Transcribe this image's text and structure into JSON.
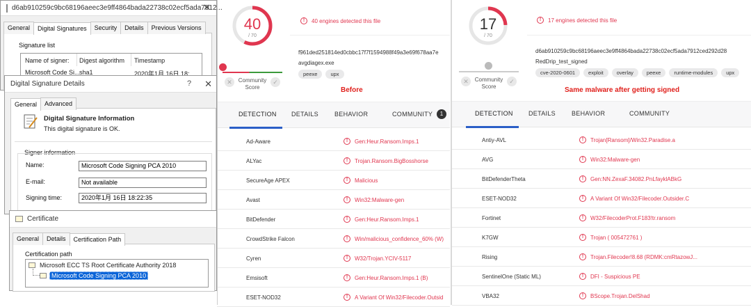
{
  "sig_list_window": {
    "title": "d6ab910259c9bc68196aeec3e9ff4864bada22738c02ecf5ada7912...",
    "tabs": [
      "General",
      "Digital Signatures",
      "Security",
      "Details",
      "Previous Versions"
    ],
    "group_label": "Signature list",
    "columns": [
      "Name of signer:",
      "Digest algorithm",
      "Timestamp"
    ],
    "row": [
      "Microsoft Code Si...",
      "sha1",
      "2020年1月 16日 18:..."
    ]
  },
  "sig_details_window": {
    "title": "Digital Signature Details",
    "help": "?",
    "tabs": [
      "General",
      "Advanced"
    ],
    "info_title": "Digital Signature Information",
    "info_text": "This digital signature is OK.",
    "group_label": "Signer information",
    "name_label": "Name:",
    "name_value": "Microsoft Code Signing PCA 2010",
    "email_label": "E-mail:",
    "email_value": "Not available",
    "time_label": "Signing time:",
    "time_value": "2020年1月 16日 18:22:35"
  },
  "cert_window": {
    "title": "Certificate",
    "tabs": [
      "General",
      "Details",
      "Certification Path"
    ],
    "path_label": "Certification path",
    "root": "Microsoft ECC TS Root Certificate Authority 2018",
    "child": "Microsoft Code Signing PCA 2010"
  },
  "vt_before": {
    "score": "40",
    "total": "/ 70",
    "alert": "40 engines detected this file",
    "hash": "f961ded251814ed0cbbc17f7f1594988f49a3e69f678aa7e",
    "filename": "avgdiagex.exe",
    "tags": [
      "peexe",
      "upx"
    ],
    "community_score": "Community Score",
    "caption": "Before",
    "nav": [
      "DETECTION",
      "DETAILS",
      "BEHAVIOR",
      "COMMUNITY"
    ],
    "community_badge": "1",
    "rows": [
      {
        "engine": "Ad-Aware",
        "result": "Gen:Heur.Ransom.Imps.1"
      },
      {
        "engine": "ALYac",
        "result": "Trojan.Ransom.BigBosshorse"
      },
      {
        "engine": "SecureAge APEX",
        "result": "Malicious"
      },
      {
        "engine": "Avast",
        "result": "Win32:Malware-gen"
      },
      {
        "engine": "BitDefender",
        "result": "Gen:Heur.Ransom.Imps.1"
      },
      {
        "engine": "CrowdStrike Falcon",
        "result": "Win/malicious_confidence_60% (W)"
      },
      {
        "engine": "Cyren",
        "result": "W32/Trojan.YCIV-5117"
      },
      {
        "engine": "Emsisoft",
        "result": "Gen:Heur.Ransom.Imps.1 (B)"
      },
      {
        "engine": "ESET-NOD32",
        "result": "A Variant Of Win32/Filecoder.Outsid"
      }
    ]
  },
  "vt_after": {
    "score": "17",
    "total": "/ 70",
    "alert": "17 engines detected this file",
    "hash": "d6ab910259c9bc68196aeec3e9ff4864bada22738c02ecf5ada7912ced292d28",
    "filename": "RedDrip_test_signed",
    "tags": [
      "cve-2020-0601",
      "exploit",
      "overlay",
      "peexe",
      "runtime-modules",
      "upx"
    ],
    "community_score": "Community Score",
    "caption": "Same malware after getting signed",
    "nav": [
      "DETECTION",
      "DETAILS",
      "BEHAVIOR",
      "COMMUNITY"
    ],
    "rows": [
      {
        "engine": "Antiy-AVL",
        "result": "Trojan[Ransom]/Win32.Paradise.a"
      },
      {
        "engine": "AVG",
        "result": "Win32:Malware-gen"
      },
      {
        "engine": "BitDefenderTheta",
        "result": "Gen:NN.ZexaF.34082.PnLfayklABkG"
      },
      {
        "engine": "ESET-NOD32",
        "result": "A Variant Of Win32/Filecoder.Outsider.C"
      },
      {
        "engine": "Fortinet",
        "result": "W32/FilecoderProt.F183!tr.ransom"
      },
      {
        "engine": "K7GW",
        "result": "Trojan ( 005472761 )"
      },
      {
        "engine": "Rising",
        "result": "Trojan.Filecoder!8.68 (RDMK:cmRtazowJ..."
      },
      {
        "engine": "SentinelOne (Static ML)",
        "result": "DFI - Suspicious PE"
      },
      {
        "engine": "VBA32",
        "result": "BScope.Trojan.DelShad"
      }
    ]
  },
  "colors": {
    "alert": "#e0364f",
    "accent": "#2b5fc7",
    "caption": "#e0201c"
  }
}
